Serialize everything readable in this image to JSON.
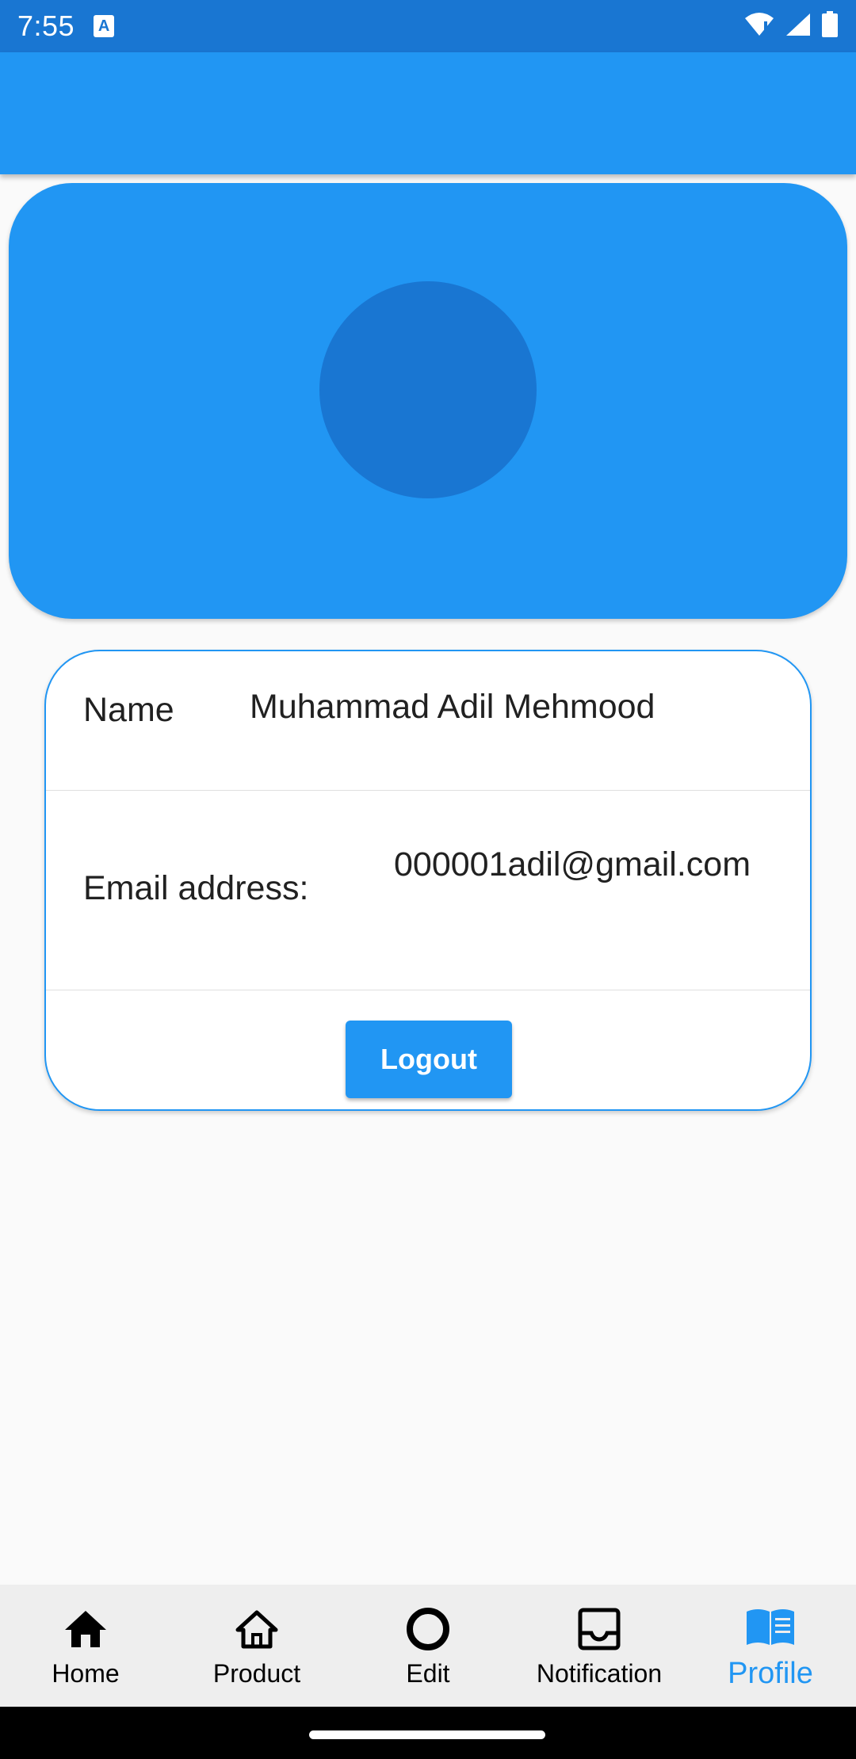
{
  "status_bar": {
    "time": "7:55",
    "notification_icon": "A",
    "icons": [
      "wifi-icon",
      "signal-icon",
      "battery-icon"
    ]
  },
  "profile": {
    "name_label": "Name",
    "name_value": "Muhammad Adil Mehmood",
    "email_label": "Email address:",
    "email_value": "000001adil@gmail.com",
    "logout_label": "Logout"
  },
  "bottom_nav": {
    "items": [
      {
        "label": "Home",
        "icon": "home-filled-icon",
        "active": false
      },
      {
        "label": "Product",
        "icon": "home-outline-icon",
        "active": false
      },
      {
        "label": "Edit",
        "icon": "circle-icon",
        "active": false
      },
      {
        "label": "Notification",
        "icon": "inbox-icon",
        "active": false
      },
      {
        "label": "Profile",
        "icon": "book-icon",
        "active": true
      }
    ]
  },
  "colors": {
    "primary": "#2196f3",
    "primary_dark": "#1976d2",
    "background": "#fafafa",
    "nav_background": "#eeeeee"
  }
}
